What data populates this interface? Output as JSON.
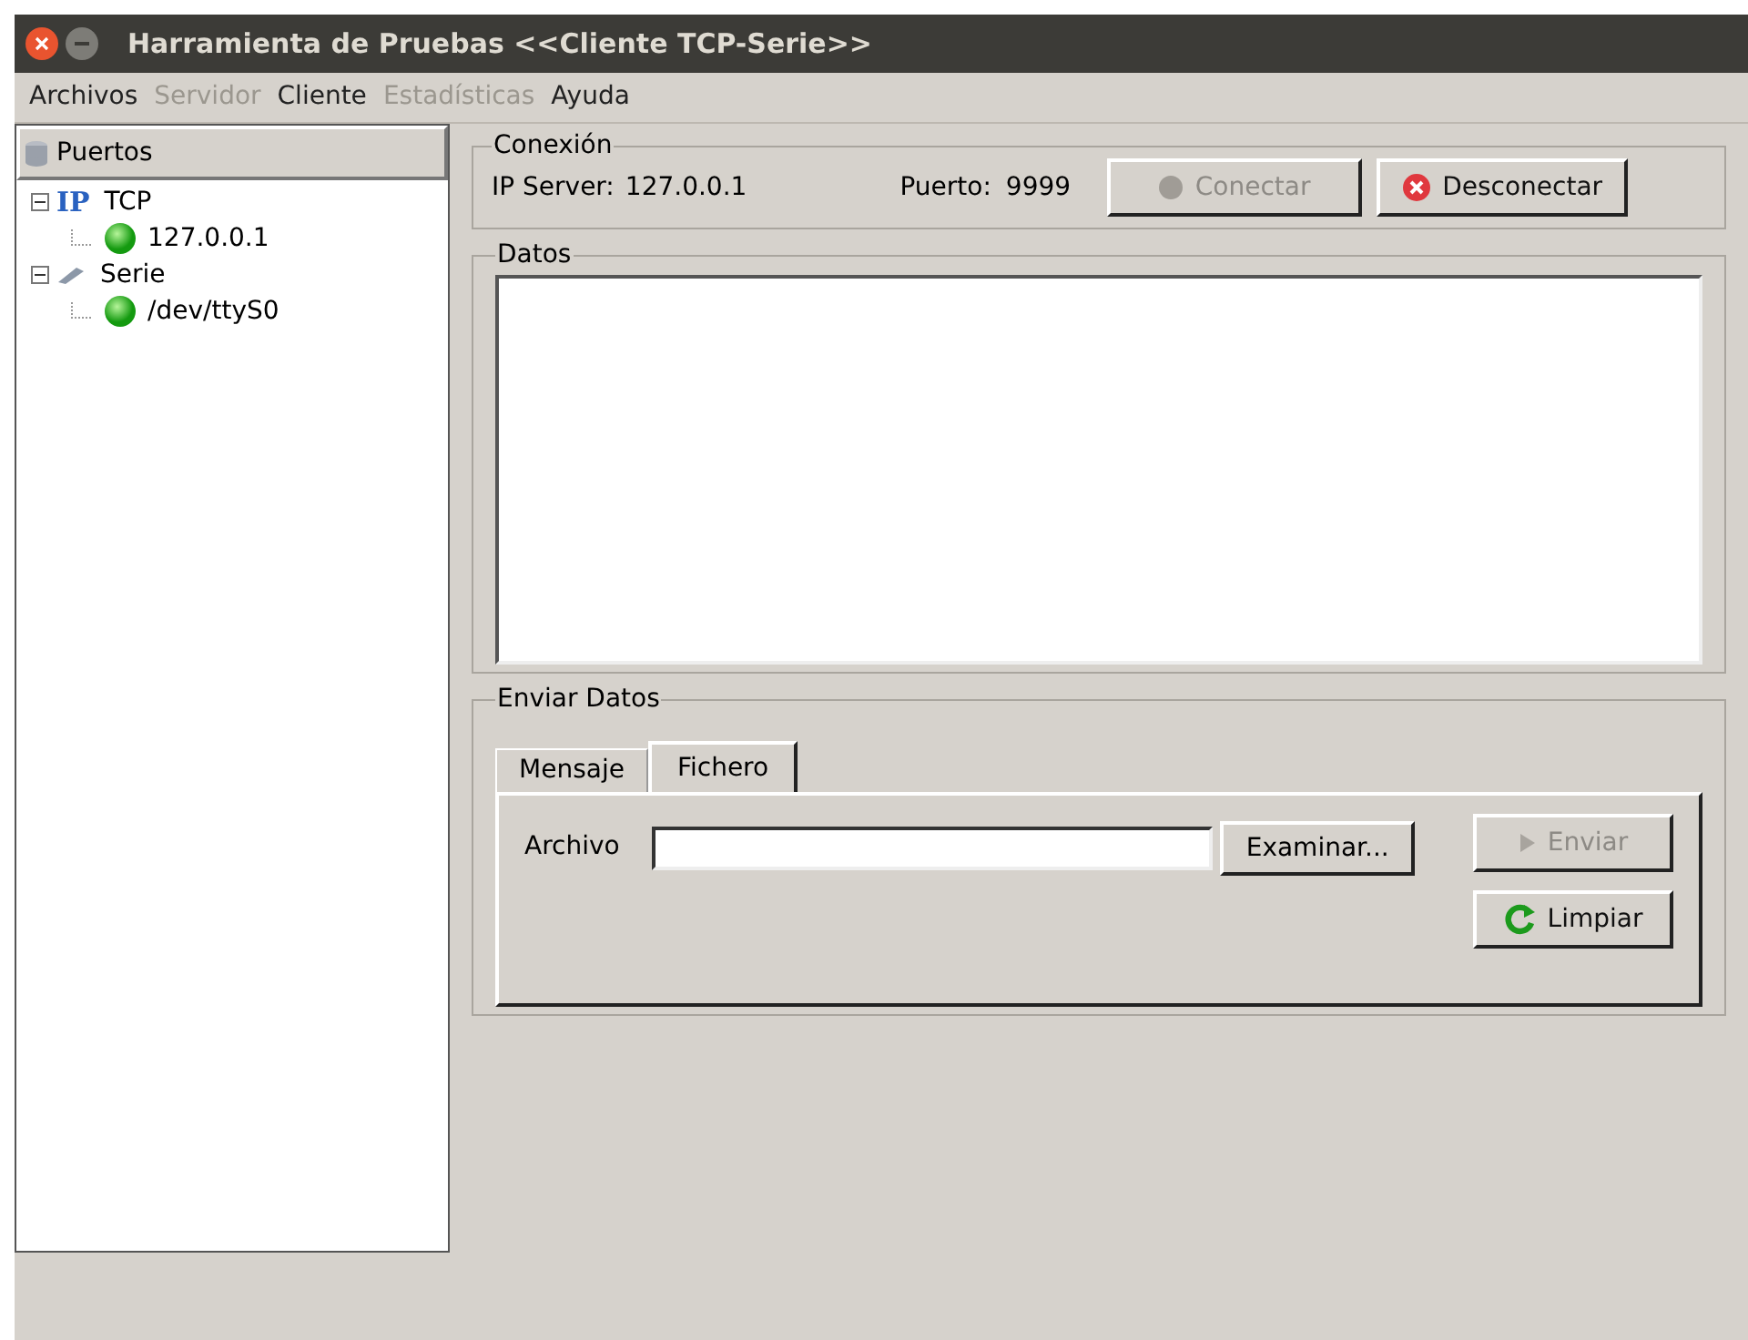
{
  "window": {
    "title": "Harramienta de Pruebas <<Cliente TCP-Serie>>"
  },
  "menu": [
    {
      "label": "Archivos",
      "disabled": false
    },
    {
      "label": "Servidor",
      "disabled": true
    },
    {
      "label": "Cliente",
      "disabled": false
    },
    {
      "label": "Estadísticas",
      "disabled": true
    },
    {
      "label": "Ayuda",
      "disabled": false
    }
  ],
  "tree": {
    "header": "Puertos",
    "items": [
      {
        "label": "TCP",
        "kind": "tcp",
        "icon_text": "IP",
        "expanded": true,
        "children": [
          {
            "label": "127.0.0.1",
            "kind": "port"
          }
        ]
      },
      {
        "label": "Serie",
        "kind": "serial",
        "expanded": true,
        "children": [
          {
            "label": "/dev/ttyS0",
            "kind": "port"
          }
        ]
      }
    ]
  },
  "connection": {
    "title": "Conexión",
    "ip_label": "IP Server:",
    "ip": "127.0.0.1",
    "port_label": "Puerto:",
    "port": "9999",
    "buttons": [
      {
        "label": "Conectar",
        "kind": "connect",
        "disabled": true
      },
      {
        "label": "Desconectar",
        "kind": "disconnect",
        "disabled": false
      }
    ]
  },
  "data": {
    "title": "Datos"
  },
  "send": {
    "title": "Enviar Datos",
    "tabs": [
      {
        "label": "Mensaje",
        "selected": false
      },
      {
        "label": "Fichero",
        "selected": true
      }
    ],
    "file_label": "Archivo",
    "browse": "Examinar...",
    "buttons": [
      {
        "label": "Enviar",
        "kind": "send",
        "disabled": true
      },
      {
        "label": "Limpiar",
        "kind": "clear",
        "disabled": false
      }
    ]
  }
}
